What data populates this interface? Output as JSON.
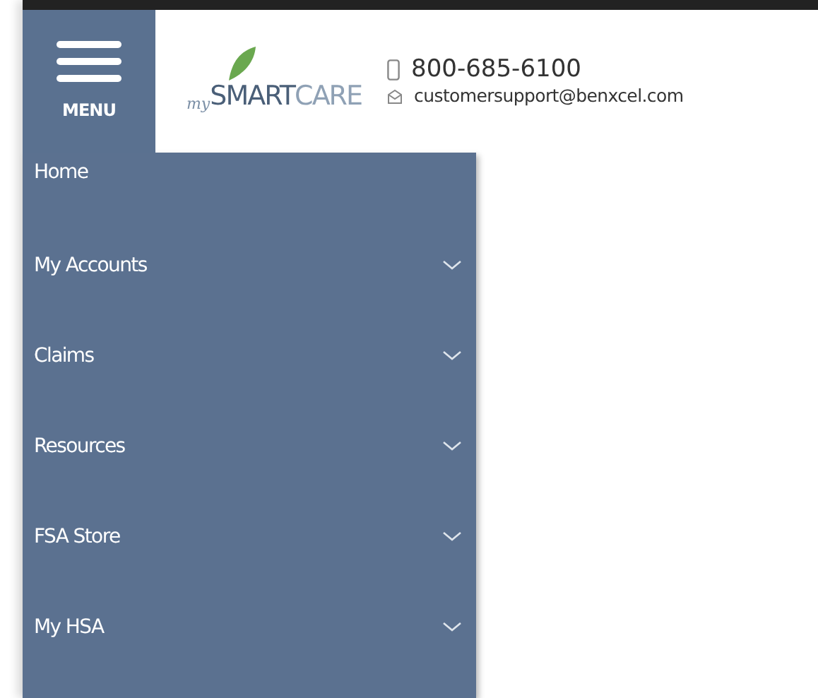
{
  "menu_button": {
    "label": "MENU"
  },
  "logo": {
    "prefix": "my",
    "main": "SMART",
    "suffix": "CARE"
  },
  "contact": {
    "phone": "800-685-6100",
    "email": "customersupport@benxcel.com"
  },
  "sidebar": {
    "items": [
      {
        "label": "Home",
        "expandable": false
      },
      {
        "label": "My Accounts",
        "expandable": true
      },
      {
        "label": "Claims",
        "expandable": true
      },
      {
        "label": "Resources",
        "expandable": true
      },
      {
        "label": "FSA Store",
        "expandable": true
      },
      {
        "label": "My HSA",
        "expandable": true
      }
    ]
  }
}
